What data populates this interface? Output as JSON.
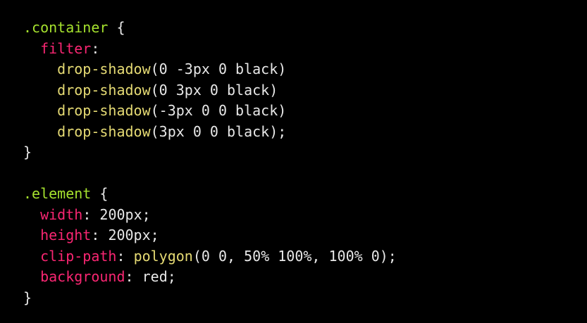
{
  "colors": {
    "background": "#000000",
    "selector": "#a6e22e",
    "property": "#f92672",
    "function": "#e6db74",
    "value": "#e8e8e8",
    "punctuation": "#e8e8e8"
  },
  "code": {
    "language": "css",
    "lines": [
      [
        {
          "t": "selector",
          "v": ".container"
        },
        {
          "t": "punctuation",
          "v": " {"
        }
      ],
      [
        {
          "t": "indent",
          "v": "  "
        },
        {
          "t": "property",
          "v": "filter"
        },
        {
          "t": "punctuation",
          "v": ":"
        }
      ],
      [
        {
          "t": "indent",
          "v": "    "
        },
        {
          "t": "function",
          "v": "drop-shadow"
        },
        {
          "t": "value",
          "v": "(0 -3px 0 black)"
        }
      ],
      [
        {
          "t": "indent",
          "v": "    "
        },
        {
          "t": "function",
          "v": "drop-shadow"
        },
        {
          "t": "value",
          "v": "(0 3px 0 black)"
        }
      ],
      [
        {
          "t": "indent",
          "v": "    "
        },
        {
          "t": "function",
          "v": "drop-shadow"
        },
        {
          "t": "value",
          "v": "(-3px 0 0 black)"
        }
      ],
      [
        {
          "t": "indent",
          "v": "    "
        },
        {
          "t": "function",
          "v": "drop-shadow"
        },
        {
          "t": "value",
          "v": "(3px 0 0 black);"
        }
      ],
      [
        {
          "t": "punctuation",
          "v": "}"
        }
      ],
      [],
      [
        {
          "t": "selector",
          "v": ".element"
        },
        {
          "t": "punctuation",
          "v": " {"
        }
      ],
      [
        {
          "t": "indent",
          "v": "  "
        },
        {
          "t": "property",
          "v": "width"
        },
        {
          "t": "punctuation",
          "v": ": "
        },
        {
          "t": "value",
          "v": "200px;"
        }
      ],
      [
        {
          "t": "indent",
          "v": "  "
        },
        {
          "t": "property",
          "v": "height"
        },
        {
          "t": "punctuation",
          "v": ": "
        },
        {
          "t": "value",
          "v": "200px;"
        }
      ],
      [
        {
          "t": "indent",
          "v": "  "
        },
        {
          "t": "property",
          "v": "clip-path"
        },
        {
          "t": "punctuation",
          "v": ": "
        },
        {
          "t": "function",
          "v": "polygon"
        },
        {
          "t": "value",
          "v": "(0 0, 50% 100%, 100% 0);"
        }
      ],
      [
        {
          "t": "indent",
          "v": "  "
        },
        {
          "t": "property",
          "v": "background"
        },
        {
          "t": "punctuation",
          "v": ": "
        },
        {
          "t": "value",
          "v": "red;"
        }
      ],
      [
        {
          "t": "punctuation",
          "v": "}"
        }
      ]
    ]
  }
}
